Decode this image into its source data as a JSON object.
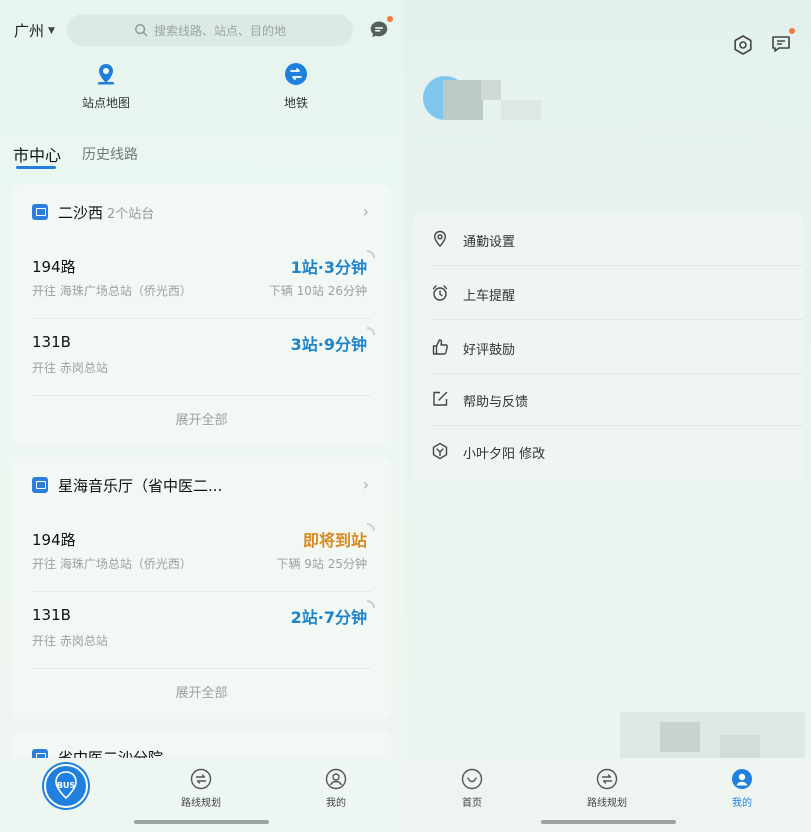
{
  "left": {
    "city": "广州",
    "search_placeholder": "搜索线路、站点、目的地",
    "quick": [
      {
        "label": "站点地图",
        "icon": "map-pin-icon"
      },
      {
        "label": "地铁",
        "icon": "metro-icon"
      }
    ],
    "tabs": {
      "active": "市中心",
      "other": "历史线路"
    },
    "stations": [
      {
        "name": "二沙西",
        "sub": "2个站台",
        "routes": [
          {
            "name": "194路",
            "dest": "开往 海珠广场总站（侨光西）",
            "eta": "1站·3分钟",
            "next": "下辆 10站 26分钟",
            "eta_color": "#1e83c9"
          },
          {
            "name": "131B",
            "dest": "开往 赤岗总站",
            "eta": "3站·9分钟",
            "next": "",
            "eta_color": "#1e83c9"
          }
        ],
        "expand": "展开全部"
      },
      {
        "name": "星海音乐厅（省中医二...",
        "sub": "",
        "routes": [
          {
            "name": "194路",
            "dest": "开往 海珠广场总站（侨光西）",
            "eta": "即将到站",
            "next": "下辆 9站 25分钟",
            "eta_color": "#d98a22"
          },
          {
            "name": "131B",
            "dest": "开往 赤岗总站",
            "eta": "2站·7分钟",
            "next": "",
            "eta_color": "#1e83c9"
          }
        ],
        "expand": "展开全部"
      }
    ],
    "partial_station": "省中医二沙分院",
    "bottom_nav": {
      "bus": "BUS",
      "route_plan": "路线规划",
      "mine": "我的"
    }
  },
  "right": {
    "menu": [
      {
        "label": "通勤设置",
        "icon": "location-pin-icon"
      },
      {
        "label": "上车提醒",
        "icon": "alarm-clock-icon"
      },
      {
        "label": "好评鼓励",
        "icon": "thumbs-up-icon"
      },
      {
        "label": "帮助与反馈",
        "icon": "edit-feedback-icon"
      },
      {
        "label": "小叶夕阳 修改",
        "icon": "hexagon-check-icon"
      }
    ],
    "bottom_nav": {
      "home": "首页",
      "route_plan": "路线规划",
      "mine": "我的"
    }
  },
  "colors": {
    "accent": "#1f80dd",
    "eta_blue": "#1e83c9",
    "eta_orange": "#d98a22",
    "badge": "#f07a3a"
  }
}
